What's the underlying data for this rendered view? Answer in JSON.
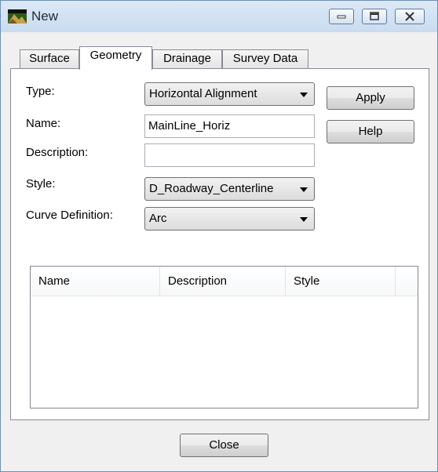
{
  "window": {
    "title": "New"
  },
  "tabs": [
    {
      "label": "Surface"
    },
    {
      "label": "Geometry",
      "active": true
    },
    {
      "label": "Drainage"
    },
    {
      "label": "Survey Data"
    }
  ],
  "form": {
    "type_label": "Type:",
    "type_value": "Horizontal Alignment",
    "name_label": "Name:",
    "name_value": "MainLine_Horiz",
    "description_label": "Description:",
    "description_value": "",
    "style_label": "Style:",
    "style_value": "D_Roadway_Centerline",
    "curve_label": "Curve Definition:",
    "curve_value": "Arc"
  },
  "buttons": {
    "apply": "Apply",
    "help": "Help",
    "close": "Close"
  },
  "list": {
    "columns": [
      "Name",
      "Description",
      "Style"
    ],
    "rows": []
  },
  "colors": {
    "title_bar": "#c9dcf0",
    "panel": "#ffffff",
    "face": "#f0f0f0"
  }
}
